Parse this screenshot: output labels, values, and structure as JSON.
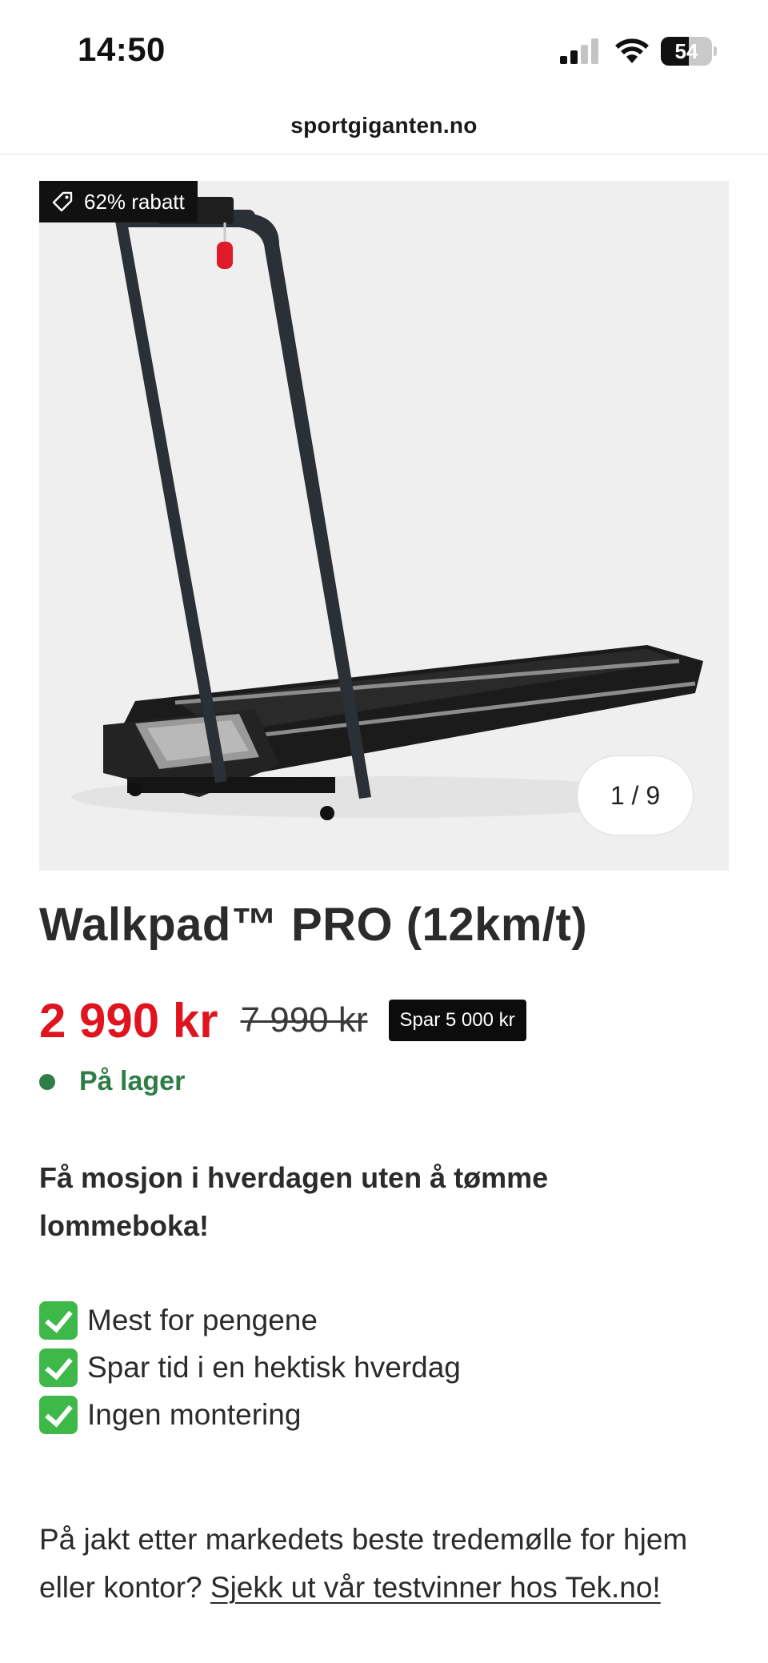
{
  "status_bar": {
    "time": "14:50",
    "battery_level": "54",
    "battery_fraction": 0.54
  },
  "browser": {
    "url": "sportgiganten.no"
  },
  "gallery": {
    "discount_label": "62% rabatt",
    "counter": "1 / 9"
  },
  "product": {
    "title": "Walkpad™ PRO (12km/t)",
    "price_current": "2 990 kr",
    "price_old": "7 990 kr",
    "save_label": "Spar 5 000 kr",
    "stock_status": "På lager",
    "stock_color": "#2f7d46",
    "price_color": "#e0141e"
  },
  "tagline": "Få mosjon i hverdagen uten å tømme lommeboka!",
  "benefits": [
    "Mest for pengene",
    "Spar tid i en hektisk hverdag",
    "Ingen montering"
  ],
  "description": {
    "text": "På jakt etter markedets beste tredemølle for hjem eller kontor? ",
    "link_text": "Sjekk ut vår testvinner hos Tek.no!"
  },
  "icons": {
    "discount": "tag-icon",
    "benefit": "check-mark-icon"
  }
}
